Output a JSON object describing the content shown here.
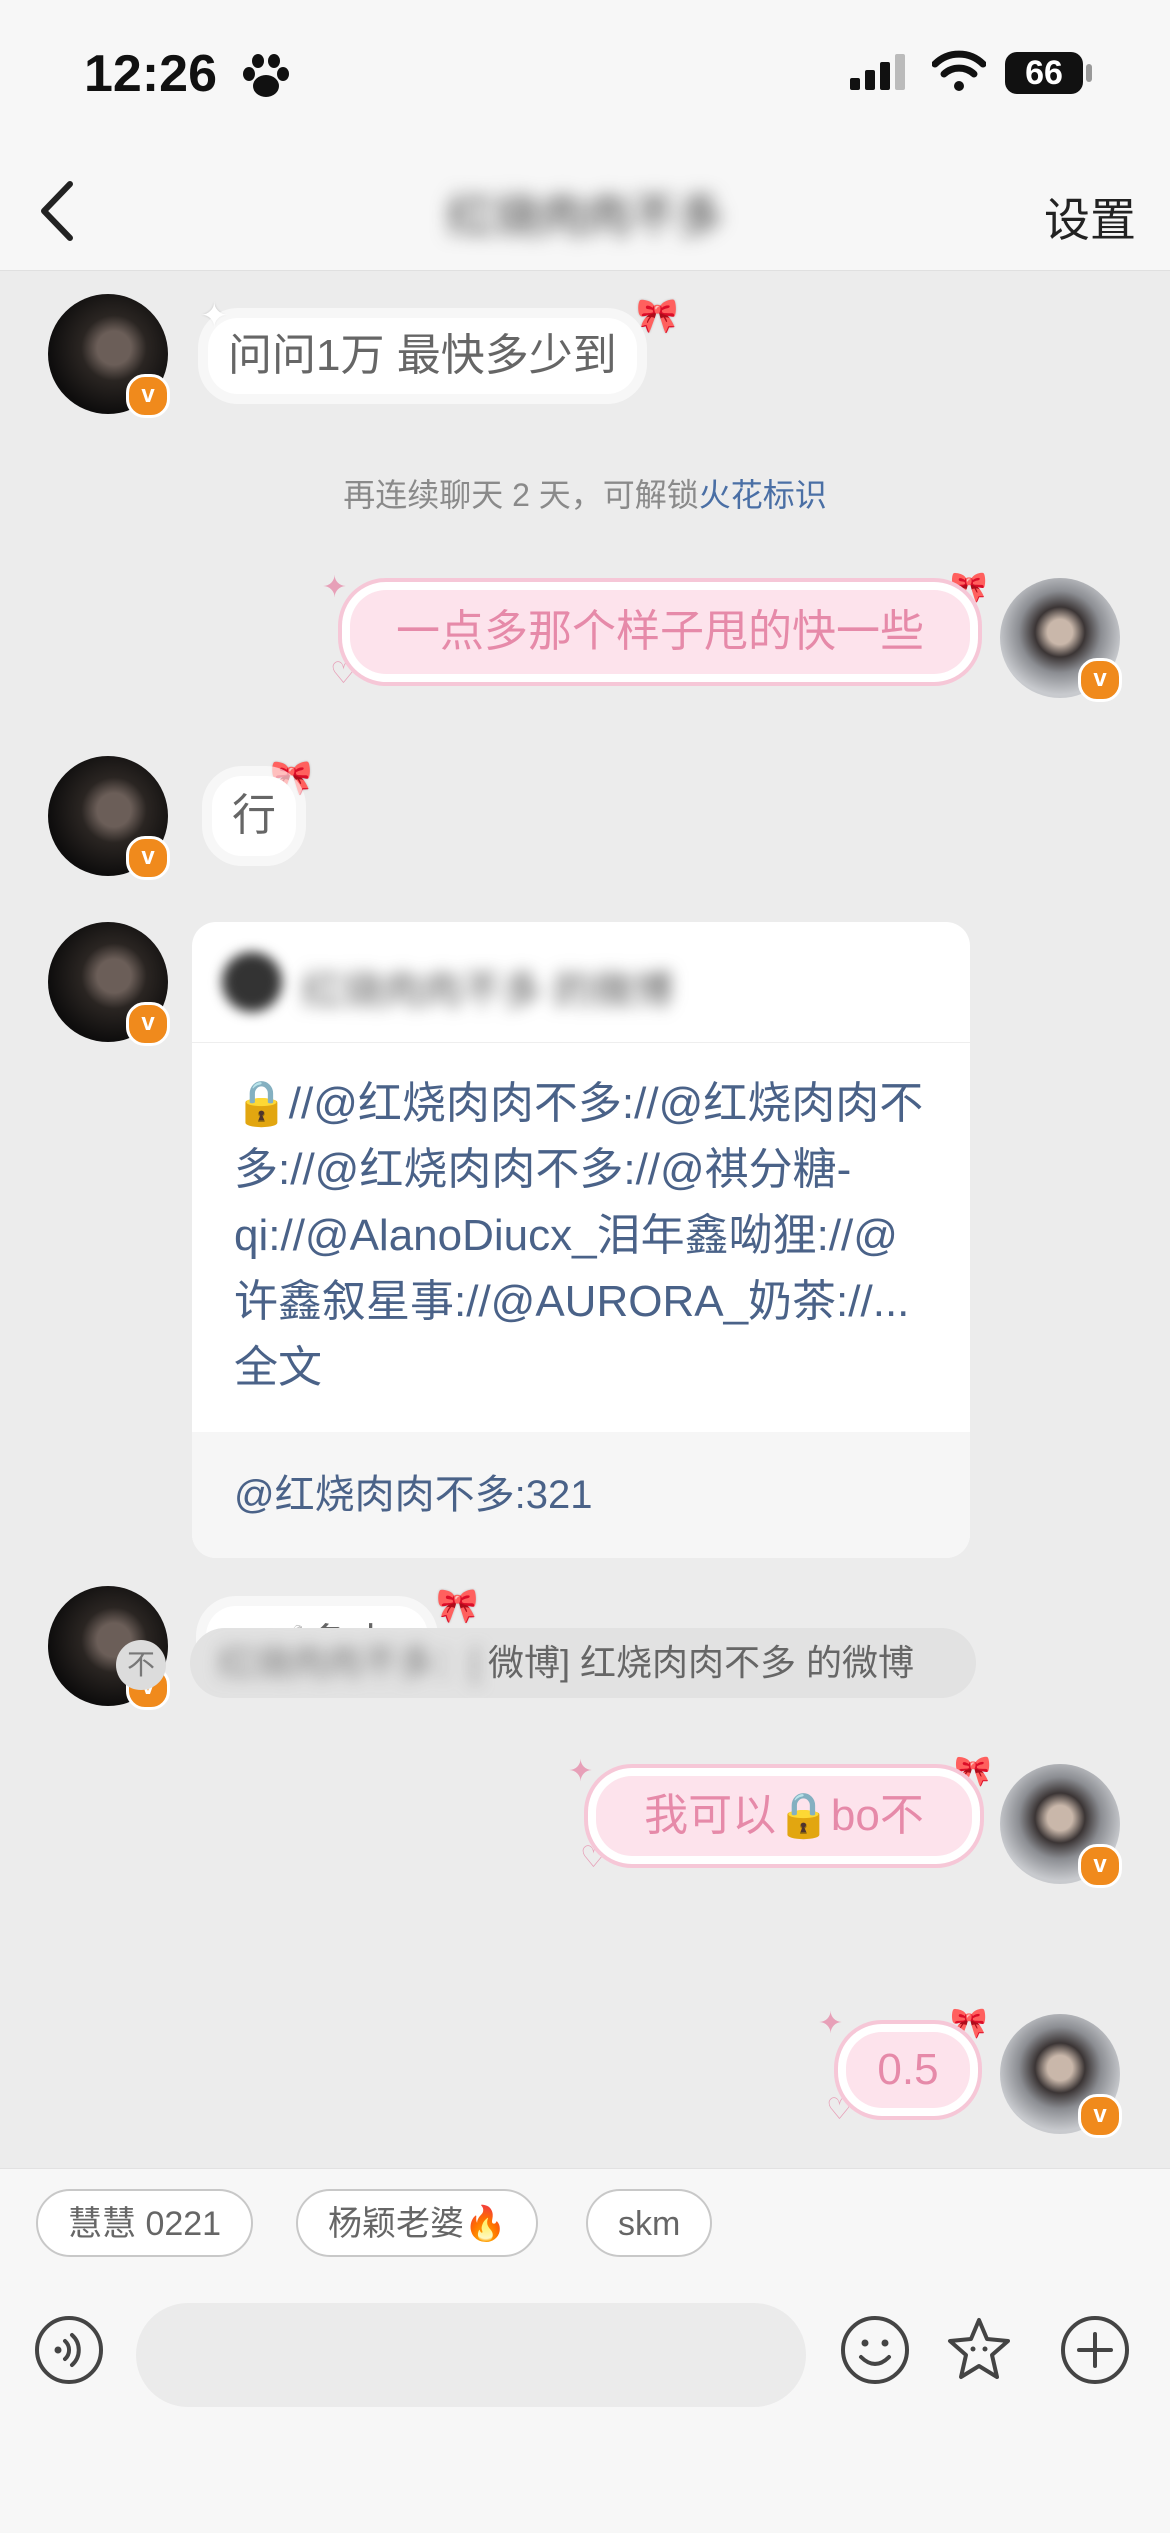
{
  "status_bar": {
    "time": "12:26",
    "battery": "66"
  },
  "nav": {
    "title": "红烧肉肉不多",
    "settings": "设置"
  },
  "messages": {
    "m1": "问问1万 最快多少到",
    "system": "再连续聊天 2 天，可解锁",
    "system_link": "火花标识",
    "m2": "一点多那个样子甩的快一些",
    "m3": "行",
    "card": {
      "author": "红烧肉肉不多 的微博",
      "text": "🔒//@红烧肉肉不多://@红烧肉肉不多://@红烧肉肉不多://@祺分糖-qi://@AlanoDiucx_泪年鑫呦狸://@许鑫叙星事://@AURORA_奶茶://...",
      "more": "全文",
      "footer": "@红烧肉肉不多:321"
    },
    "m4": "1🥣多少r",
    "m5": "我可以🔒bo不",
    "quote_blurred": "红烧肉肉不多：[",
    "quote_text": "微博] 红烧肉肉不多 的微博",
    "quote_icon": "不",
    "m6": "0.5"
  },
  "quick_replies": [
    "慧慧 0221",
    "杨颖老婆🔥",
    "skm"
  ],
  "icons": [
    "back-icon",
    "voice-icon",
    "emoji-icon",
    "sticker-icon",
    "plus-icon",
    "verified-badge-icon"
  ],
  "colors": {
    "accent_link": "#4a6fa5",
    "bubble_pink": "#fde3ec",
    "text_pink": "#e68aa9",
    "badge_orange": "#f08a1c"
  }
}
